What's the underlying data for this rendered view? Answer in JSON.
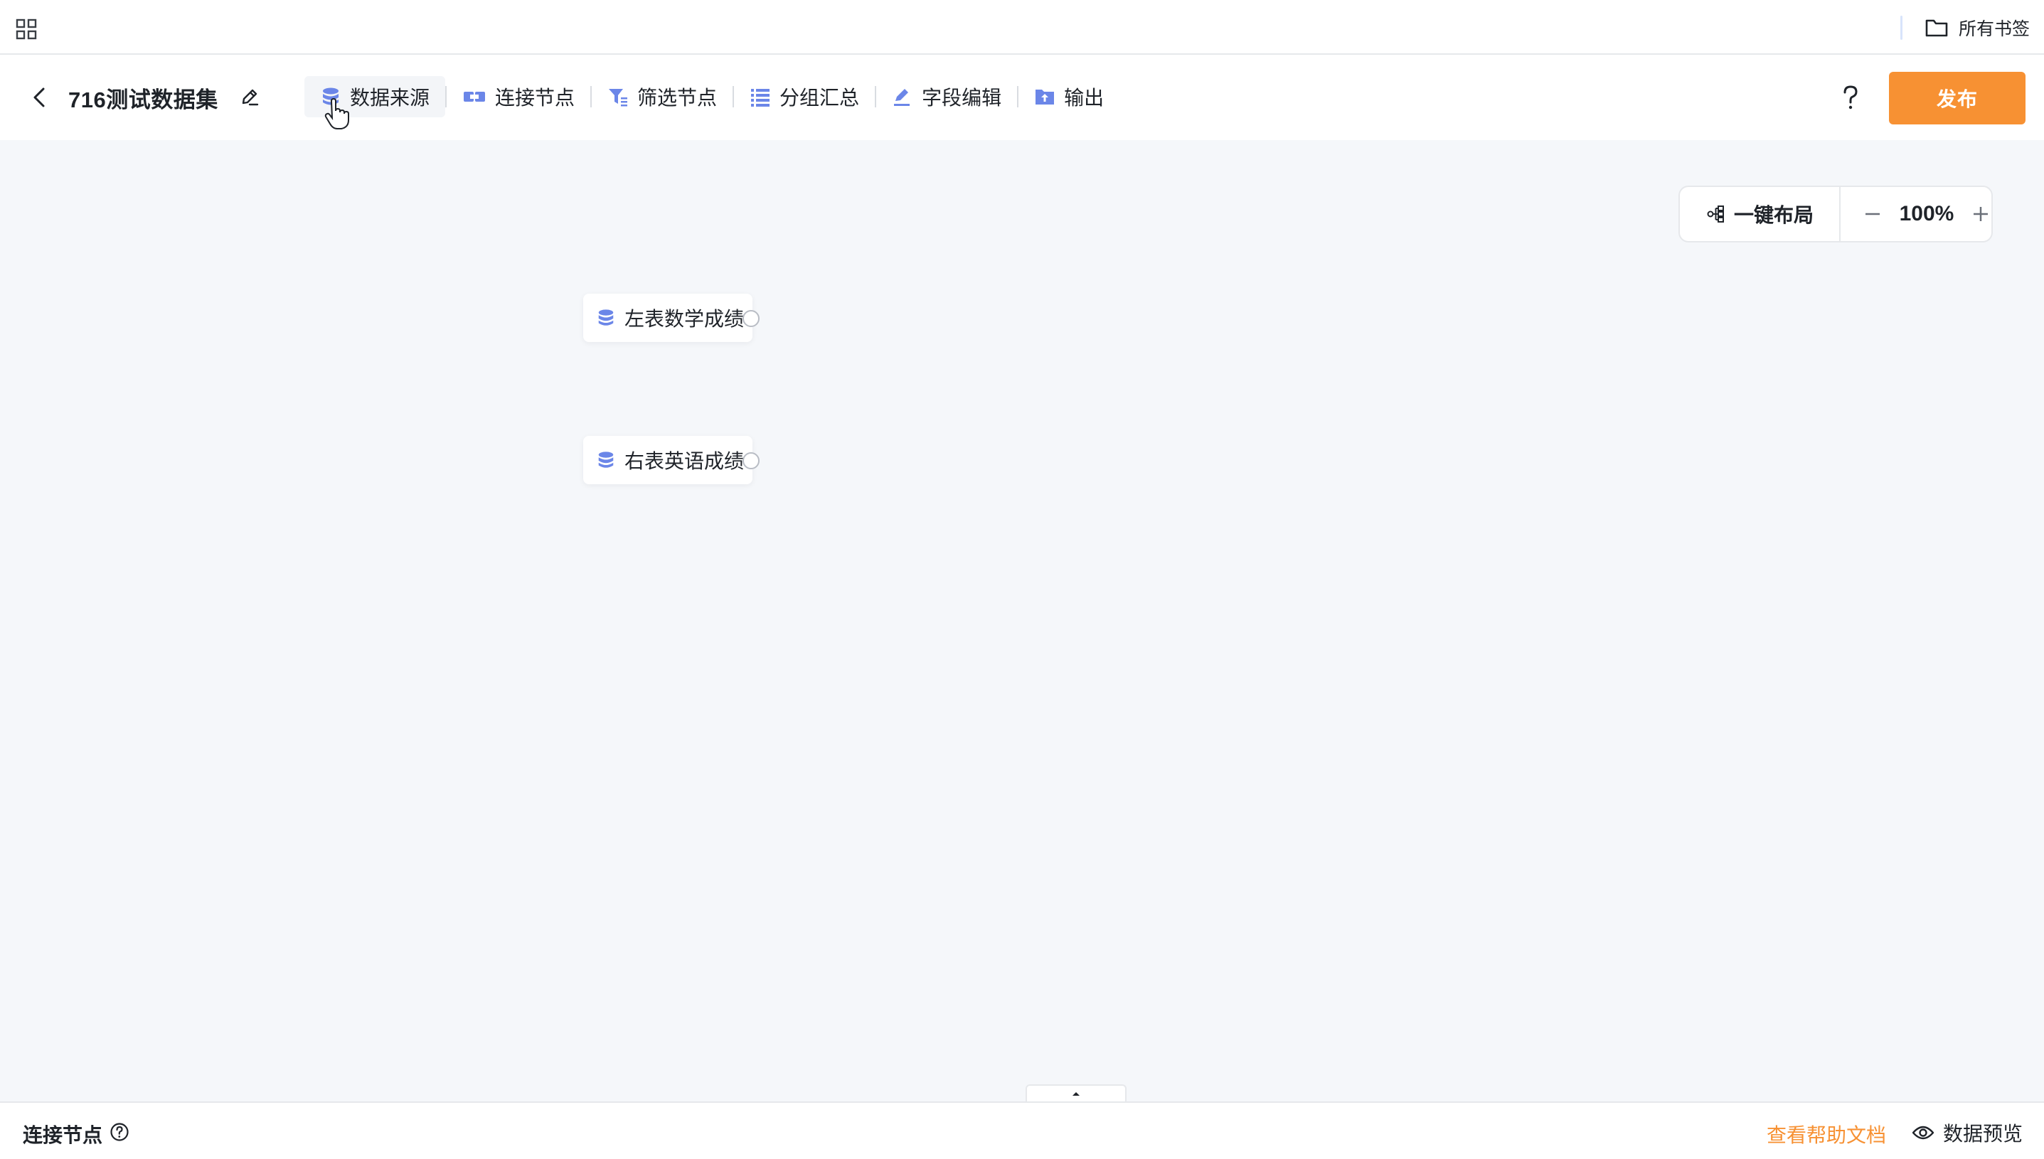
{
  "topbar": {
    "apps_icon": "grid-apps-icon",
    "bookmarks_label": "所有书签",
    "bookmarks_icon": "folder-icon"
  },
  "header": {
    "title": "716测试数据集",
    "back_icon": "chevron-left-icon",
    "edit_icon": "pencil-icon",
    "help_icon": "question-icon",
    "publish_label": "发布",
    "tools": [
      {
        "label": "数据来源",
        "icon": "database-icon"
      },
      {
        "label": "连接节点",
        "icon": "join-icon"
      },
      {
        "label": "筛选节点",
        "icon": "filter-icon"
      },
      {
        "label": "分组汇总",
        "icon": "list-icon"
      },
      {
        "label": "字段编辑",
        "icon": "pencil-icon"
      },
      {
        "label": "输出",
        "icon": "export-icon"
      }
    ]
  },
  "canvas": {
    "auto_layout_label": "一键布局",
    "zoom_value": "100%",
    "nodes": [
      {
        "label": "左表数学成绩",
        "icon": "database-icon"
      },
      {
        "label": "右表英语成绩",
        "icon": "database-icon"
      }
    ]
  },
  "bottom_panel": {
    "title": "连接节点",
    "help_doc_label": "查看帮助文档",
    "preview_label": "数据预览"
  },
  "colors": {
    "accent": "#f79133",
    "icon_blue": "#6b86e8",
    "canvas_bg": "#f5f7fa"
  }
}
